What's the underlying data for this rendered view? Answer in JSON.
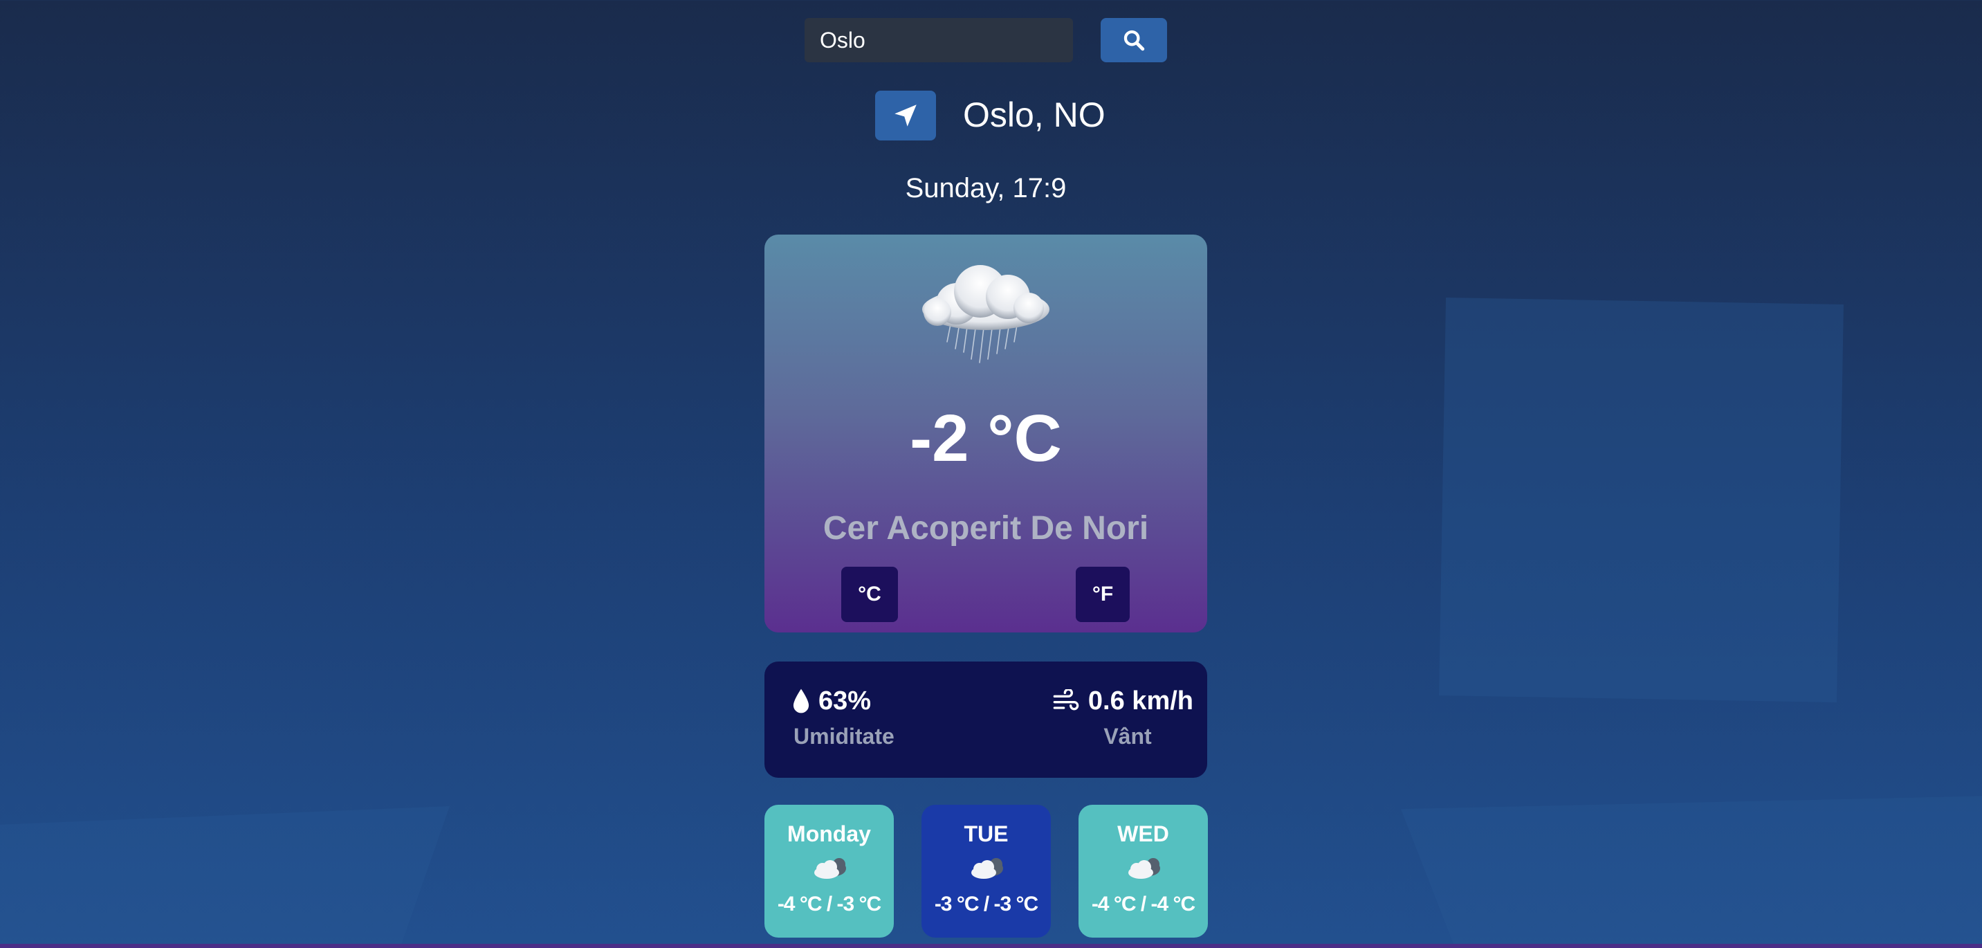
{
  "search": {
    "value": "Oslo",
    "button_icon": "search-icon"
  },
  "location": {
    "button_icon": "location-arrow-icon",
    "city": "Oslo, NO"
  },
  "datetime": "Sunday, 17:9",
  "current": {
    "icon": "rain-cloud-icon",
    "temperature": "-2 °C",
    "description": "Cer Acoperit De Nori",
    "unit_celsius_label": "°C",
    "unit_fahrenheit_label": "°F"
  },
  "details": {
    "humidity": {
      "icon": "droplet-icon",
      "value": "63%",
      "label": "Umiditate"
    },
    "wind": {
      "icon": "wind-icon",
      "value": "0.6 km/h",
      "label": "Vânt"
    }
  },
  "forecast": [
    {
      "day": "Monday",
      "icon": "cloud-icon",
      "temp": "-4 °C / -3 °C",
      "color": "#55c0c0"
    },
    {
      "day": "TUE",
      "icon": "cloud-icon",
      "temp": "-3 °C / -3 °C",
      "color": "#1a3aa8"
    },
    {
      "day": "WED",
      "icon": "cloud-icon",
      "temp": "-4 °C / -4 °C",
      "color": "#55c0c0"
    }
  ],
  "colors": {
    "background_top": "#1a2b4c",
    "background_bottom": "#22508f",
    "accent_button": "#2e63a8",
    "details_card": "#0e1250",
    "unit_button": "#1c0f5c"
  }
}
